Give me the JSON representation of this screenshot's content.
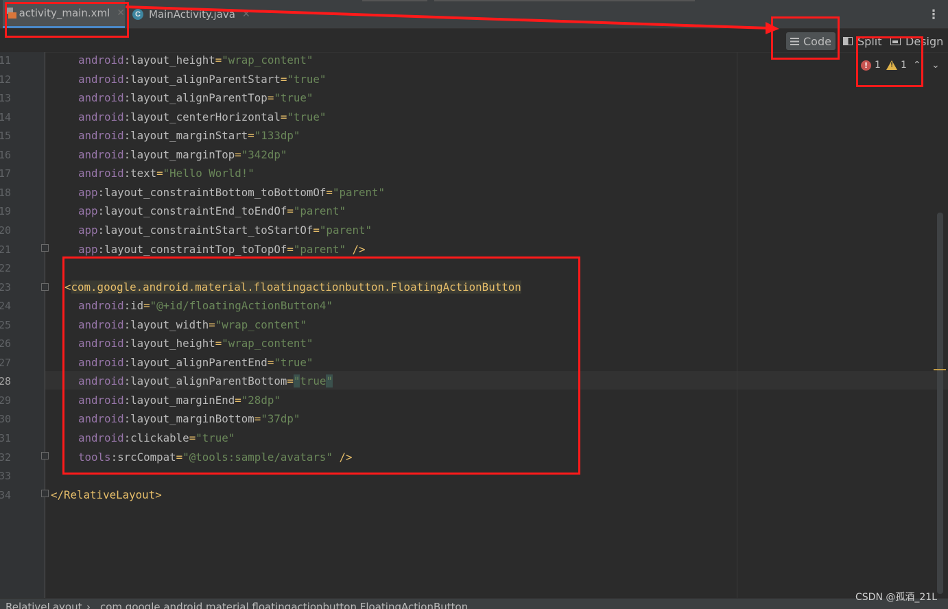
{
  "tabs": [
    {
      "label": "activity_main.xml",
      "icon": "xml-file-icon",
      "active": true
    },
    {
      "label": "MainActivity.java",
      "icon": "java-class-icon",
      "active": false
    }
  ],
  "view_modes": {
    "code": "Code",
    "split": "Split",
    "design": "Design",
    "selected": "Code"
  },
  "inspections": {
    "errors": "1",
    "warnings": "1"
  },
  "current_line": 28,
  "lines": [
    {
      "n": "11",
      "indent": 4,
      "parts": [
        [
          "ns",
          "android"
        ],
        [
          "attr",
          ":layout_height"
        ],
        [
          "punc",
          "="
        ],
        [
          "str",
          "\"wrap_content\""
        ]
      ]
    },
    {
      "n": "12",
      "indent": 4,
      "parts": [
        [
          "ns",
          "android"
        ],
        [
          "attr",
          ":layout_alignParentStart"
        ],
        [
          "punc",
          "="
        ],
        [
          "str",
          "\"true\""
        ]
      ]
    },
    {
      "n": "13",
      "indent": 4,
      "parts": [
        [
          "ns",
          "android"
        ],
        [
          "attr",
          ":layout_alignParentTop"
        ],
        [
          "punc",
          "="
        ],
        [
          "str",
          "\"true\""
        ]
      ]
    },
    {
      "n": "14",
      "indent": 4,
      "parts": [
        [
          "ns",
          "android"
        ],
        [
          "attr",
          ":layout_centerHorizontal"
        ],
        [
          "punc",
          "="
        ],
        [
          "str",
          "\"true\""
        ]
      ]
    },
    {
      "n": "15",
      "indent": 4,
      "parts": [
        [
          "ns",
          "android"
        ],
        [
          "attr",
          ":layout_marginStart"
        ],
        [
          "punc",
          "="
        ],
        [
          "str",
          "\"133dp\""
        ]
      ]
    },
    {
      "n": "16",
      "indent": 4,
      "parts": [
        [
          "ns",
          "android"
        ],
        [
          "attr",
          ":layout_marginTop"
        ],
        [
          "punc",
          "="
        ],
        [
          "str",
          "\"342dp\""
        ]
      ]
    },
    {
      "n": "17",
      "indent": 4,
      "parts": [
        [
          "ns",
          "android"
        ],
        [
          "attr",
          ":text"
        ],
        [
          "punc",
          "="
        ],
        [
          "str",
          "\"Hello World!\""
        ]
      ]
    },
    {
      "n": "18",
      "indent": 4,
      "parts": [
        [
          "ns",
          "app"
        ],
        [
          "attr",
          ":layout_constraintBottom_toBottomOf"
        ],
        [
          "punc",
          "="
        ],
        [
          "str",
          "\"parent\""
        ]
      ]
    },
    {
      "n": "19",
      "indent": 4,
      "parts": [
        [
          "ns",
          "app"
        ],
        [
          "attr",
          ":layout_constraintEnd_toEndOf"
        ],
        [
          "punc",
          "="
        ],
        [
          "str",
          "\"parent\""
        ]
      ]
    },
    {
      "n": "20",
      "indent": 4,
      "parts": [
        [
          "ns",
          "app"
        ],
        [
          "attr",
          ":layout_constraintStart_toStartOf"
        ],
        [
          "punc",
          "="
        ],
        [
          "str",
          "\"parent\""
        ]
      ]
    },
    {
      "n": "21",
      "indent": 4,
      "parts": [
        [
          "ns",
          "app"
        ],
        [
          "attr",
          ":layout_constraintTop_toTopOf"
        ],
        [
          "punc",
          "="
        ],
        [
          "str",
          "\"parent\""
        ],
        [
          "attr",
          " "
        ],
        [
          "punc",
          "/>"
        ]
      ]
    },
    {
      "n": "22",
      "indent": 0,
      "parts": []
    },
    {
      "n": "23",
      "indent": 2,
      "parts": [
        [
          "punc",
          "<"
        ],
        [
          "tag hl",
          "com.google.android.material.floatingactionbutton.FloatingActionButton"
        ]
      ]
    },
    {
      "n": "24",
      "indent": 4,
      "parts": [
        [
          "ns",
          "android"
        ],
        [
          "attr",
          ":id"
        ],
        [
          "punc",
          "="
        ],
        [
          "str",
          "\"@+id/floatingActionButton4\""
        ]
      ]
    },
    {
      "n": "25",
      "indent": 4,
      "parts": [
        [
          "ns",
          "android"
        ],
        [
          "attr",
          ":layout_width"
        ],
        [
          "punc",
          "="
        ],
        [
          "str",
          "\"wrap_content\""
        ]
      ]
    },
    {
      "n": "26",
      "indent": 4,
      "parts": [
        [
          "ns",
          "android"
        ],
        [
          "attr",
          ":layout_height"
        ],
        [
          "punc",
          "="
        ],
        [
          "str",
          "\"wrap_content\""
        ]
      ]
    },
    {
      "n": "27",
      "indent": 4,
      "parts": [
        [
          "ns",
          "android"
        ],
        [
          "attr",
          ":layout_alignParentEnd"
        ],
        [
          "punc",
          "="
        ],
        [
          "str",
          "\"true\""
        ]
      ]
    },
    {
      "n": "28",
      "indent": 4,
      "parts": [
        [
          "ns",
          "android"
        ],
        [
          "attr",
          ":layout_alignParentBottom"
        ],
        [
          "punc",
          "="
        ],
        [
          "str caret-hl",
          "\""
        ],
        [
          "str",
          "true"
        ],
        [
          "str caret-hl",
          "\""
        ]
      ]
    },
    {
      "n": "29",
      "indent": 4,
      "parts": [
        [
          "ns",
          "android"
        ],
        [
          "attr",
          ":layout_marginEnd"
        ],
        [
          "punc",
          "="
        ],
        [
          "str",
          "\"28dp\""
        ]
      ]
    },
    {
      "n": "30",
      "indent": 4,
      "parts": [
        [
          "ns",
          "android"
        ],
        [
          "attr",
          ":layout_marginBottom"
        ],
        [
          "punc",
          "="
        ],
        [
          "str",
          "\"37dp\""
        ]
      ]
    },
    {
      "n": "31",
      "indent": 4,
      "parts": [
        [
          "ns",
          "android"
        ],
        [
          "attr",
          ":clickable"
        ],
        [
          "punc",
          "="
        ],
        [
          "str",
          "\"true\""
        ]
      ]
    },
    {
      "n": "32",
      "indent": 4,
      "parts": [
        [
          "ns",
          "tools"
        ],
        [
          "attr",
          ":srcCompat"
        ],
        [
          "punc",
          "="
        ],
        [
          "str",
          "\"@tools:sample/avatars\""
        ],
        [
          "attr",
          " "
        ],
        [
          "punc",
          "/>"
        ]
      ]
    },
    {
      "n": "33",
      "indent": 0,
      "parts": []
    },
    {
      "n": "34",
      "indent": 0,
      "parts": [
        [
          "punc",
          "</"
        ],
        [
          "tag",
          "RelativeLayout"
        ],
        [
          "punc",
          ">"
        ]
      ]
    }
  ],
  "breadcrumb": {
    "item1": "RelativeLayout",
    "sep": "›",
    "item2": "com.google.android.material.floatingactionbutton.FloatingActionButton"
  },
  "watermark": "CSDN @孤酒_21L",
  "colors": {
    "annotation": "#ff1a1a",
    "background": "#2b2b2b",
    "string": "#6a8759",
    "namespace": "#9876aa",
    "tag": "#e8bf6a"
  }
}
